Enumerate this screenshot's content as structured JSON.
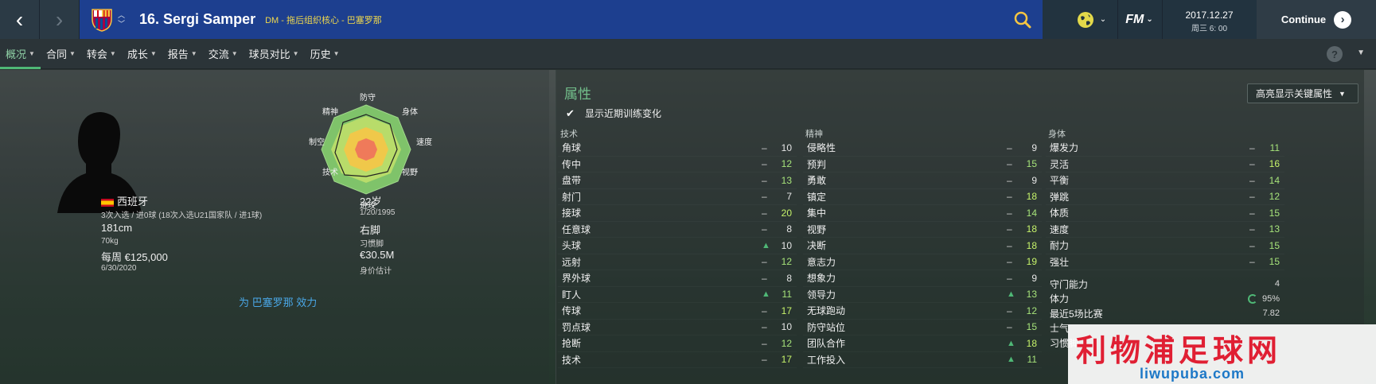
{
  "header": {
    "player_title": "16. Sergi Samper",
    "player_sub": "DM - 拖后组织核心 - 巴塞罗那",
    "date": "2017.12.27",
    "time": "周三 6: 00",
    "continue_label": "Continue",
    "fm_label": "FM",
    "back_icon": "chevron-left-icon",
    "forward_icon": "chevron-right-icon"
  },
  "tabs": [
    {
      "label": "概况"
    },
    {
      "label": "合同"
    },
    {
      "label": "转会"
    },
    {
      "label": "成长"
    },
    {
      "label": "报告"
    },
    {
      "label": "交流"
    },
    {
      "label": "球员对比"
    },
    {
      "label": "历史"
    }
  ],
  "profile": {
    "nationality": "西班牙",
    "caps": "3次入选 / 进0球 (18次入选U21国家队 / 进1球)",
    "height": "181cm",
    "weight": "70kg",
    "wage": "每周 €125,000",
    "contract_end": "6/30/2020",
    "age": "22岁",
    "dob": "1/20/1995",
    "foot": "右脚",
    "foot_label": "习惯脚",
    "value": "€30.5M",
    "value_label": "身价估计",
    "play_for": "为 巴塞罗那 效力"
  },
  "radar": {
    "labels": [
      "防守",
      "身体",
      "速度",
      "视野",
      "进攻",
      "技术",
      "制空",
      "精神"
    ]
  },
  "attributes": {
    "title": "属性",
    "highlight_label": "高亮显示关键属性",
    "show_training_label": "显示近期训练变化",
    "technical": {
      "header": "技术",
      "rows": [
        {
          "name": "角球",
          "trend": "–",
          "value": "10"
        },
        {
          "name": "传中",
          "trend": "–",
          "value": "12"
        },
        {
          "name": "盘带",
          "trend": "–",
          "value": "13"
        },
        {
          "name": "射门",
          "trend": "–",
          "value": "7"
        },
        {
          "name": "接球",
          "trend": "–",
          "value": "20"
        },
        {
          "name": "任意球",
          "trend": "–",
          "value": "8"
        },
        {
          "name": "头球",
          "trend": "▲",
          "value": "10"
        },
        {
          "name": "远射",
          "trend": "–",
          "value": "12"
        },
        {
          "name": "界外球",
          "trend": "–",
          "value": "8"
        },
        {
          "name": "盯人",
          "trend": "▲",
          "value": "11"
        },
        {
          "name": "传球",
          "trend": "–",
          "value": "17"
        },
        {
          "name": "罚点球",
          "trend": "–",
          "value": "10"
        },
        {
          "name": "抢断",
          "trend": "–",
          "value": "12"
        },
        {
          "name": "技术",
          "trend": "–",
          "value": "17"
        }
      ]
    },
    "mental": {
      "header": "精神",
      "rows": [
        {
          "name": "侵略性",
          "trend": "–",
          "value": "9"
        },
        {
          "name": "预判",
          "trend": "–",
          "value": "15"
        },
        {
          "name": "勇敢",
          "trend": "–",
          "value": "9"
        },
        {
          "name": "镇定",
          "trend": "–",
          "value": "18"
        },
        {
          "name": "集中",
          "trend": "–",
          "value": "14"
        },
        {
          "name": "视野",
          "trend": "–",
          "value": "18"
        },
        {
          "name": "决断",
          "trend": "–",
          "value": "18"
        },
        {
          "name": "意志力",
          "trend": "–",
          "value": "19"
        },
        {
          "name": "想象力",
          "trend": "–",
          "value": "9"
        },
        {
          "name": "领导力",
          "trend": "▲",
          "value": "13"
        },
        {
          "name": "无球跑动",
          "trend": "–",
          "value": "12"
        },
        {
          "name": "防守站位",
          "trend": "–",
          "value": "15"
        },
        {
          "name": "团队合作",
          "trend": "▲",
          "value": "18"
        },
        {
          "name": "工作投入",
          "trend": "▲",
          "value": "11"
        }
      ]
    },
    "physical": {
      "header": "身体",
      "rows": [
        {
          "name": "爆发力",
          "trend": "–",
          "value": "11"
        },
        {
          "name": "灵活",
          "trend": "–",
          "value": "16"
        },
        {
          "name": "平衡",
          "trend": "–",
          "value": "14"
        },
        {
          "name": "弹跳",
          "trend": "–",
          "value": "12"
        },
        {
          "name": "体质",
          "trend": "–",
          "value": "15"
        },
        {
          "name": "速度",
          "trend": "–",
          "value": "13"
        },
        {
          "name": "耐力",
          "trend": "–",
          "value": "15"
        },
        {
          "name": "强壮",
          "trend": "–",
          "value": "15"
        }
      ],
      "extra": [
        {
          "name": "守门能力",
          "value": "4"
        },
        {
          "name": "体力",
          "value": "95%"
        },
        {
          "name": "最近5场比赛",
          "value": "7.82"
        },
        {
          "name": "士气",
          "value": ""
        },
        {
          "name": "习惯脚",
          "value": ""
        }
      ]
    }
  },
  "watermark": {
    "title": "利物浦足球网",
    "url": "liwupuba.com"
  },
  "colors": {
    "header_blue": "#1d3f8f",
    "accent_green": "#4fb876",
    "player_sub_yellow": "#f0d84c",
    "link_blue": "#4aa7e6",
    "watermark_red": "#e01f33"
  }
}
